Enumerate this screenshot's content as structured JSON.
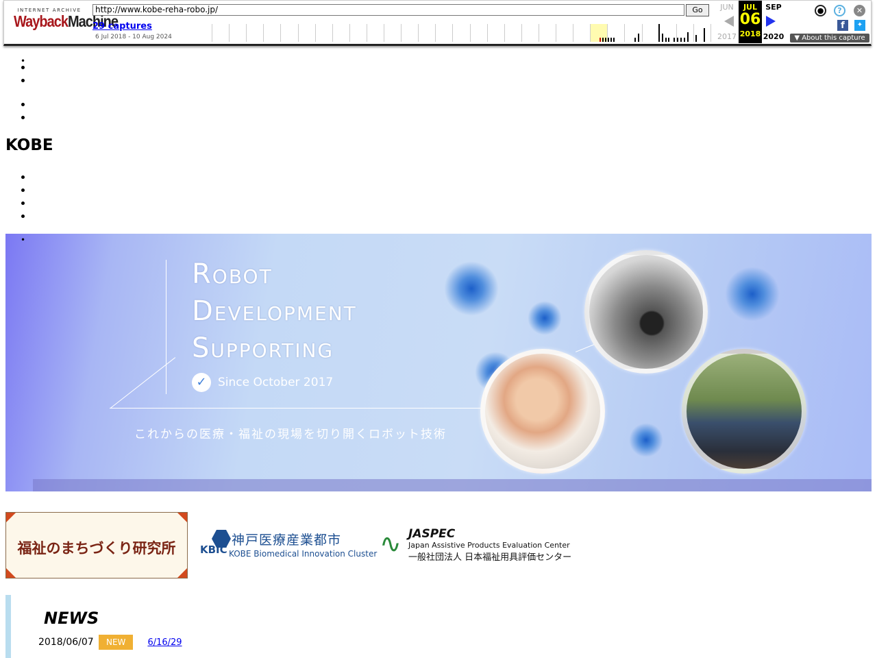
{
  "wayback": {
    "logo_top": "INTERNET ARCHIVE",
    "logo_main_a": "Wayback",
    "logo_main_b": "Machine",
    "url": "http://www.kobe-reha-robo.jp/",
    "go_label": "Go",
    "captures": "29 captures",
    "range": "6 Jul 2018 - 10 Aug 2024",
    "prev_month": "JUN",
    "prev_year": "2017",
    "current_month": "JUL",
    "current_day": "06",
    "current_year": "2018",
    "next_month": "SEP",
    "next_year": "2020",
    "about": "About this capture",
    "icons": [
      "user-icon",
      "help-icon",
      "close-icon",
      "facebook-icon",
      "twitter-icon"
    ]
  },
  "top_links": [
    "",
    ""
  ],
  "lang_links": [
    " ",
    ""
  ],
  "site_title": "KOBE",
  "global_nav": [
    "",
    "",
    "",
    ""
  ],
  "hero": {
    "line1": "Robot",
    "line2": "Development",
    "line3": "Supporting",
    "since": "Since October 2017",
    "tagline": "これからの医療・福祉の現場を切り開くロボット技術"
  },
  "banners": {
    "b1": "福祉のまちづくり研究所",
    "b2_mark": "KBIC",
    "b2_jp": "神戸医療産業都市",
    "b2_en": "KOBE Biomedical Innovation Cluster",
    "b3_abbr": "JASPEC",
    "b3_en": "Japan Assistive Products Evaluation Center",
    "b3_jp": "一般社団法人 日本福祉用具評価センター"
  },
  "news": {
    "title": "NEWS",
    "items": [
      {
        "date": "2018/06/07",
        "badge": "NEW",
        "text": "6/16/29"
      }
    ]
  },
  "colors": {
    "news_badge": "#f0b033",
    "news_accent": "#b9ddef",
    "wayback_year_bg": "#000000"
  }
}
